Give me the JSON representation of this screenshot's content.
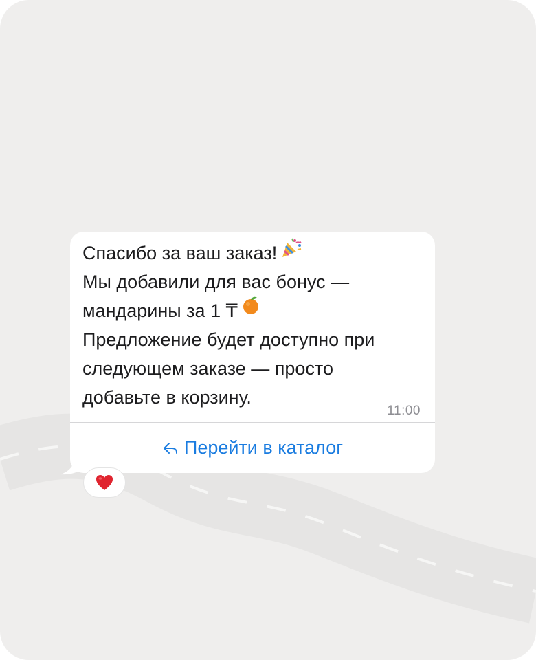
{
  "message": {
    "lines": [
      "Спасибо за ваш заказ!",
      "Мы добавили для вас бонус —",
      "мандарины за 1 ₸",
      "Предложение будет доступно при",
      "следующем заказе — просто",
      "добавьте в корзину."
    ],
    "emojis": {
      "line1": "party-popper-icon",
      "line3": "tangerine-icon"
    },
    "time": "11:00"
  },
  "action": {
    "label": "Перейти в каталог",
    "icon": "reply-arrow-icon",
    "color": "#1a7ce0"
  },
  "reaction": {
    "icon": "red-heart-icon",
    "color": "#e0242f"
  },
  "colors": {
    "background": "#efeeed",
    "bubble": "#ffffff",
    "text": "#1c1c1e",
    "time": "#8e8e93"
  }
}
